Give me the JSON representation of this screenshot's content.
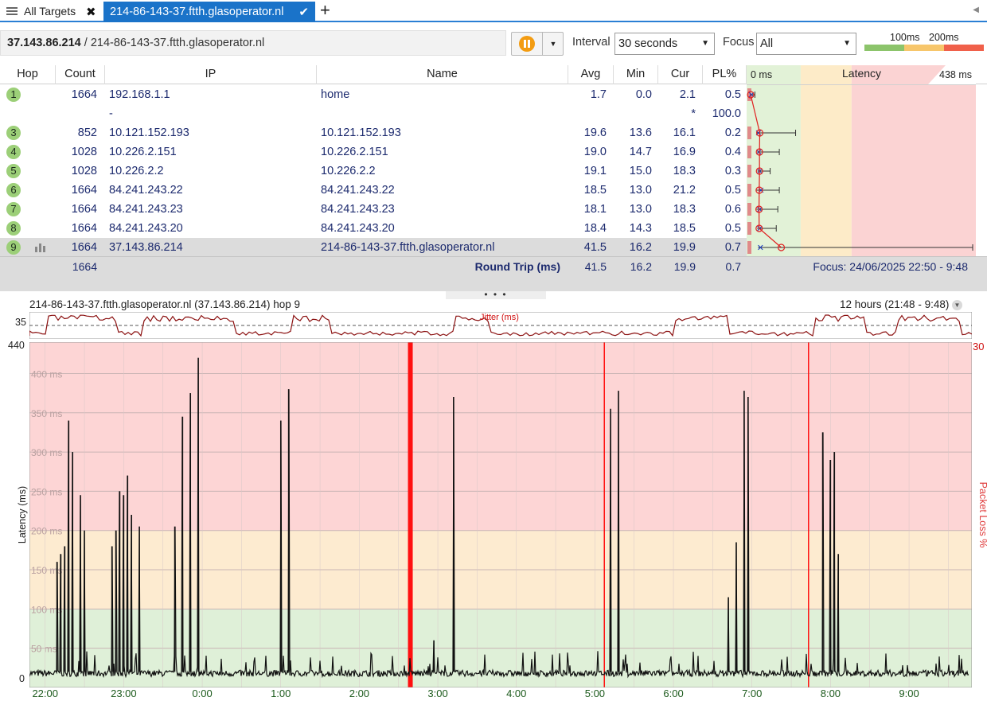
{
  "tabs": {
    "all_label": "All Targets",
    "active_label": "214-86-143-37.ftth.glasoperator.nl"
  },
  "toolbar": {
    "addr_ip": "37.143.86.214",
    "addr_host": " / 214-86-143-37.ftth.glasoperator.nl",
    "interval_label": "Interval",
    "interval_value": "30 seconds",
    "focus_label": "Focus",
    "focus_value": "All",
    "legend_100": "100ms",
    "legend_200": "200ms"
  },
  "table": {
    "headers": [
      "Hop",
      "Count",
      "IP",
      "Name",
      "Avg",
      "Min",
      "Cur",
      "PL%"
    ],
    "latency_header": "Latency",
    "latency_min": "0 ms",
    "latency_max": "438 ms",
    "latency_max_value": 438,
    "rows": [
      {
        "hop": "1",
        "count": "1664",
        "ip": "192.168.1.1",
        "name": "home",
        "avg": "1.7",
        "min": "0.0",
        "cur": "2.1",
        "pl": "0.5",
        "max": 10
      },
      {
        "hop": "",
        "count": "",
        "ip": "-",
        "name": "",
        "avg": "",
        "min": "",
        "cur": "*",
        "pl": "100.0",
        "max": 0
      },
      {
        "hop": "3",
        "count": "852",
        "ip": "10.121.152.193",
        "name": "10.121.152.193",
        "avg": "19.6",
        "min": "13.6",
        "cur": "16.1",
        "pl": "0.2",
        "max": 90
      },
      {
        "hop": "4",
        "count": "1028",
        "ip": "10.226.2.151",
        "name": "10.226.2.151",
        "avg": "19.0",
        "min": "14.7",
        "cur": "16.9",
        "pl": "0.4",
        "max": 58
      },
      {
        "hop": "5",
        "count": "1028",
        "ip": "10.226.2.2",
        "name": "10.226.2.2",
        "avg": "19.1",
        "min": "15.0",
        "cur": "18.3",
        "pl": "0.3",
        "max": 40
      },
      {
        "hop": "6",
        "count": "1664",
        "ip": "84.241.243.22",
        "name": "84.241.243.22",
        "avg": "18.5",
        "min": "13.0",
        "cur": "21.2",
        "pl": "0.5",
        "max": 58
      },
      {
        "hop": "7",
        "count": "1664",
        "ip": "84.241.243.23",
        "name": "84.241.243.23",
        "avg": "18.1",
        "min": "13.0",
        "cur": "18.3",
        "pl": "0.6",
        "max": 55
      },
      {
        "hop": "8",
        "count": "1664",
        "ip": "84.241.243.20",
        "name": "84.241.243.20",
        "avg": "18.4",
        "min": "14.3",
        "cur": "18.5",
        "pl": "0.5",
        "max": 52
      },
      {
        "hop": "9",
        "count": "1664",
        "ip": "37.143.86.214",
        "name": "214-86-143-37.ftth.glasoperator.nl",
        "avg": "41.5",
        "min": "16.2",
        "cur": "19.9",
        "pl": "0.7",
        "max": 438
      }
    ],
    "summary": {
      "count": "1664",
      "label": "Round Trip (ms)",
      "avg": "41.5",
      "min": "16.2",
      "cur": "19.9",
      "pl": "0.7",
      "focus": "Focus: 24/06/2025 22:50 - 9:48"
    }
  },
  "graph": {
    "title": "214-86-143-37.ftth.glasoperator.nl (37.143.86.214) hop 9",
    "range": "12 hours (21:48 - 9:48)",
    "jitter_label": "Jitter (ms)",
    "jitter_axis": "35",
    "y_label": "Latency (ms)",
    "y2_label": "Packet Loss %",
    "y_max": "440",
    "y_min": "0",
    "y2_max": "30",
    "grid_labels": [
      "50 ms",
      "100 ms",
      "150 ms",
      "200 ms",
      "250 ms",
      "300 ms",
      "350 ms",
      "400 ms"
    ],
    "x_labels": [
      "22:00",
      "23:00",
      "0:00",
      "1:00",
      "2:00",
      "3:00",
      "4:00",
      "5:00",
      "6:00",
      "7:00",
      "8:00",
      "9:00"
    ],
    "chart_data": {
      "type": "line",
      "ylabel": "Latency (ms)",
      "y2label": "Packet Loss %",
      "ylim": [
        0,
        440
      ],
      "y2lim": [
        0,
        30
      ],
      "spikes": [
        {
          "t": 22.15,
          "v": 160
        },
        {
          "t": 22.2,
          "v": 170
        },
        {
          "t": 22.25,
          "v": 180
        },
        {
          "t": 22.3,
          "v": 340
        },
        {
          "t": 22.35,
          "v": 300
        },
        {
          "t": 22.45,
          "v": 245
        },
        {
          "t": 22.5,
          "v": 200
        },
        {
          "t": 22.85,
          "v": 180
        },
        {
          "t": 22.9,
          "v": 200
        },
        {
          "t": 22.95,
          "v": 250
        },
        {
          "t": 23.0,
          "v": 245
        },
        {
          "t": 23.05,
          "v": 270
        },
        {
          "t": 23.1,
          "v": 220
        },
        {
          "t": 23.2,
          "v": 205
        },
        {
          "t": 23.65,
          "v": 205
        },
        {
          "t": 23.75,
          "v": 345
        },
        {
          "t": 23.85,
          "v": 375
        },
        {
          "t": 23.95,
          "v": 420
        },
        {
          "t": 25.0,
          "v": 340
        },
        {
          "t": 25.1,
          "v": 380
        },
        {
          "t": 26.95,
          "v": 60
        },
        {
          "t": 27.2,
          "v": 370
        },
        {
          "t": 29.2,
          "v": 355
        },
        {
          "t": 29.3,
          "v": 378
        },
        {
          "t": 30.7,
          "v": 115
        },
        {
          "t": 30.8,
          "v": 185
        },
        {
          "t": 30.9,
          "v": 378
        },
        {
          "t": 30.95,
          "v": 370
        },
        {
          "t": 31.9,
          "v": 325
        },
        {
          "t": 32.0,
          "v": 290
        },
        {
          "t": 32.05,
          "v": 300
        },
        {
          "t": 32.1,
          "v": 170
        }
      ],
      "packet_loss": [
        {
          "t": 26.65,
          "v": 30
        },
        {
          "t": 29.12,
          "v": 30
        },
        {
          "t": 31.72,
          "v": 30
        }
      ]
    }
  }
}
